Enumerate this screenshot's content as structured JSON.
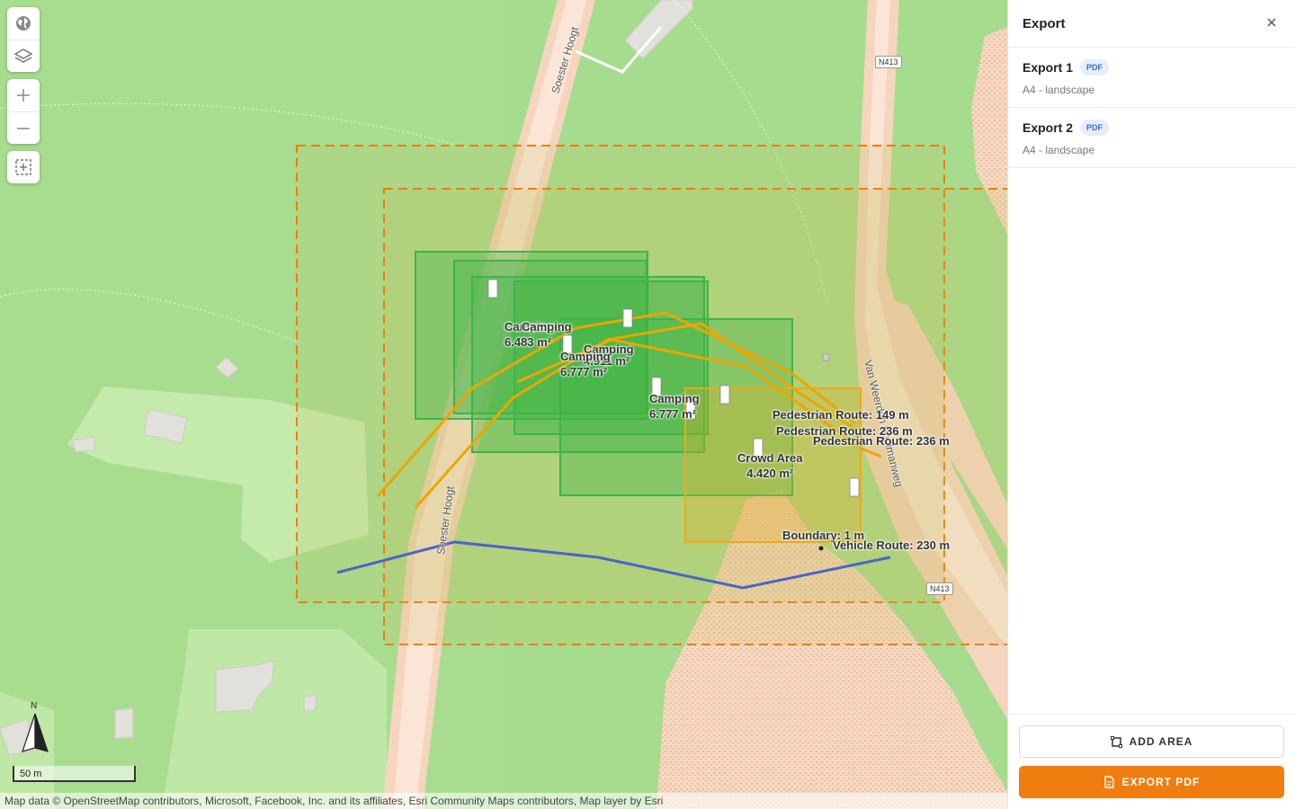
{
  "panel": {
    "title": "Export",
    "exports": [
      {
        "name": "Export 1",
        "format": "PDF",
        "paper": "A4 - landscape"
      },
      {
        "name": "Export 2",
        "format": "PDF",
        "paper": "A4 - landscape"
      }
    ],
    "add_area_label": "ADD AREA",
    "export_pdf_label": "EXPORT PDF",
    "accent_color": "#f07d10"
  },
  "map": {
    "labels": {
      "camping_1": "Camping",
      "camping_1_area": "6.483 m²",
      "camping_2": "Camping",
      "camping_2_area": "6.777 m²",
      "camping_3": "Camping",
      "camping_3_area": "4.911 m²",
      "camping_4": "Camping",
      "camping_4_area": "6.777 m²",
      "camping_5": "Camping",
      "camping_5_area": "6.777 m²",
      "crowd_area": "Crowd Area",
      "crowd_area_size": "4.420 m²",
      "ped_route_1": "Pedestrian Route: 149 m",
      "ped_route_2": "Pedestrian Route: 236 m",
      "ped_route_3": "Pedestrian Route: 236 m",
      "boundary": "Boundary: 1 m",
      "vehicle_route": "Vehicle Route: 230 m"
    },
    "roads": {
      "soester_hoogt_top": "Soester Hoogt",
      "soester_hoogt_bottom": "Soester Hoogt",
      "van_weerden": "Van Weerden Poelmanweg",
      "n413_a": "N413",
      "n413_b": "N413"
    },
    "controls": [
      "globe-icon",
      "layers-icon",
      "zoom-in-icon",
      "zoom-out-icon",
      "select-area-icon"
    ],
    "north_label": "N",
    "scale_label": "50 m",
    "attribution": "Map data © OpenStreetMap contributors, Microsoft, Facebook, Inc. and its affiliates, Esri Community Maps contributors, Map layer by Esri"
  }
}
